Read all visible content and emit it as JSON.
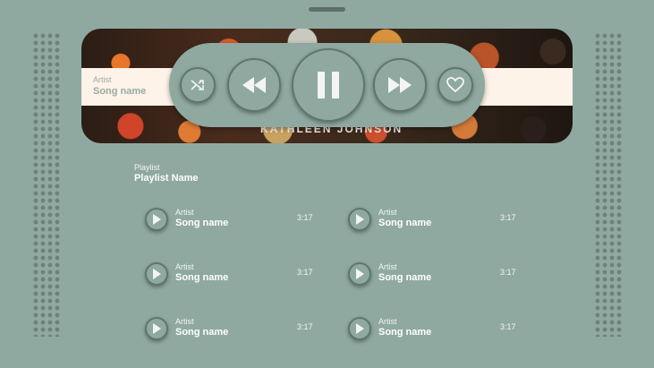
{
  "hero": {
    "artist": "Artist",
    "song": "Song name",
    "caption": "KATHLEEN JOHNSON"
  },
  "controls": {
    "shuffle": "shuffle-icon",
    "rewind": "rewind-icon",
    "pause": "pause-icon",
    "forward": "fast-forward-icon",
    "favorite": "heart-icon"
  },
  "playlist": {
    "label": "Playlist",
    "name": "Playlist Name",
    "tracks": [
      {
        "artist": "Artist",
        "song": "Song name",
        "duration": "3:17"
      },
      {
        "artist": "Artist",
        "song": "Song name",
        "duration": "3:17"
      },
      {
        "artist": "Artist",
        "song": "Song name",
        "duration": "3:17"
      },
      {
        "artist": "Artist",
        "song": "Song name",
        "duration": "3:17"
      },
      {
        "artist": "Artist",
        "song": "Song name",
        "duration": "3:17"
      },
      {
        "artist": "Artist",
        "song": "Song name",
        "duration": "3:17"
      }
    ]
  },
  "colors": {
    "background": "#8fa9a1",
    "band": "#fdf3e8",
    "outline": "#5f7670"
  }
}
